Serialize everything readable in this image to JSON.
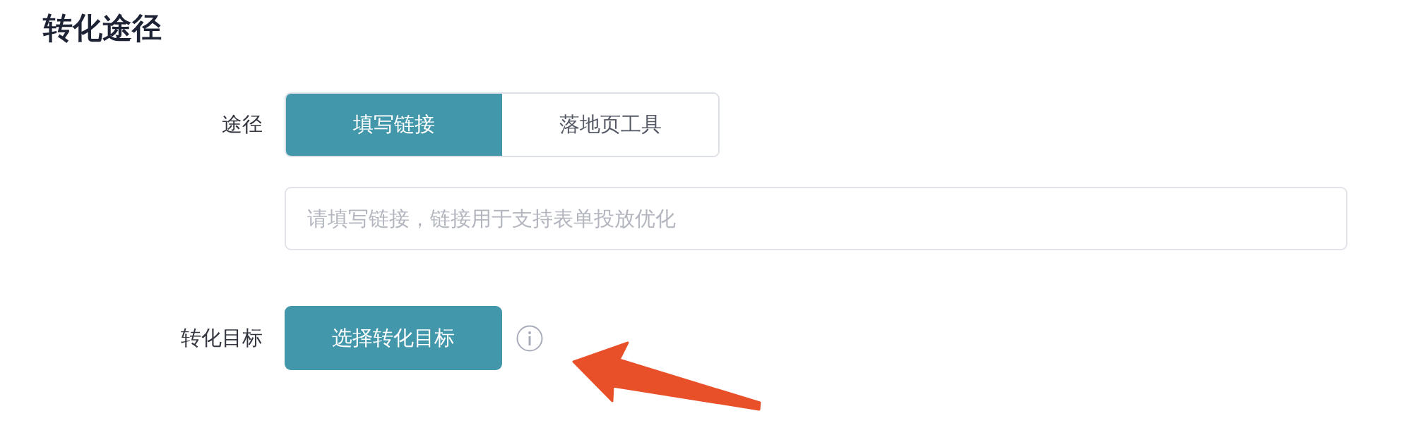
{
  "section": {
    "title": "转化途径"
  },
  "path_field": {
    "label": "途径",
    "options": [
      {
        "label": "填写链接",
        "selected": true
      },
      {
        "label": "落地页工具",
        "selected": false
      }
    ],
    "input": {
      "placeholder": "请填写链接，链接用于支持表单投放优化"
    }
  },
  "goal_field": {
    "label": "转化目标",
    "button": "选择转化目标"
  }
}
